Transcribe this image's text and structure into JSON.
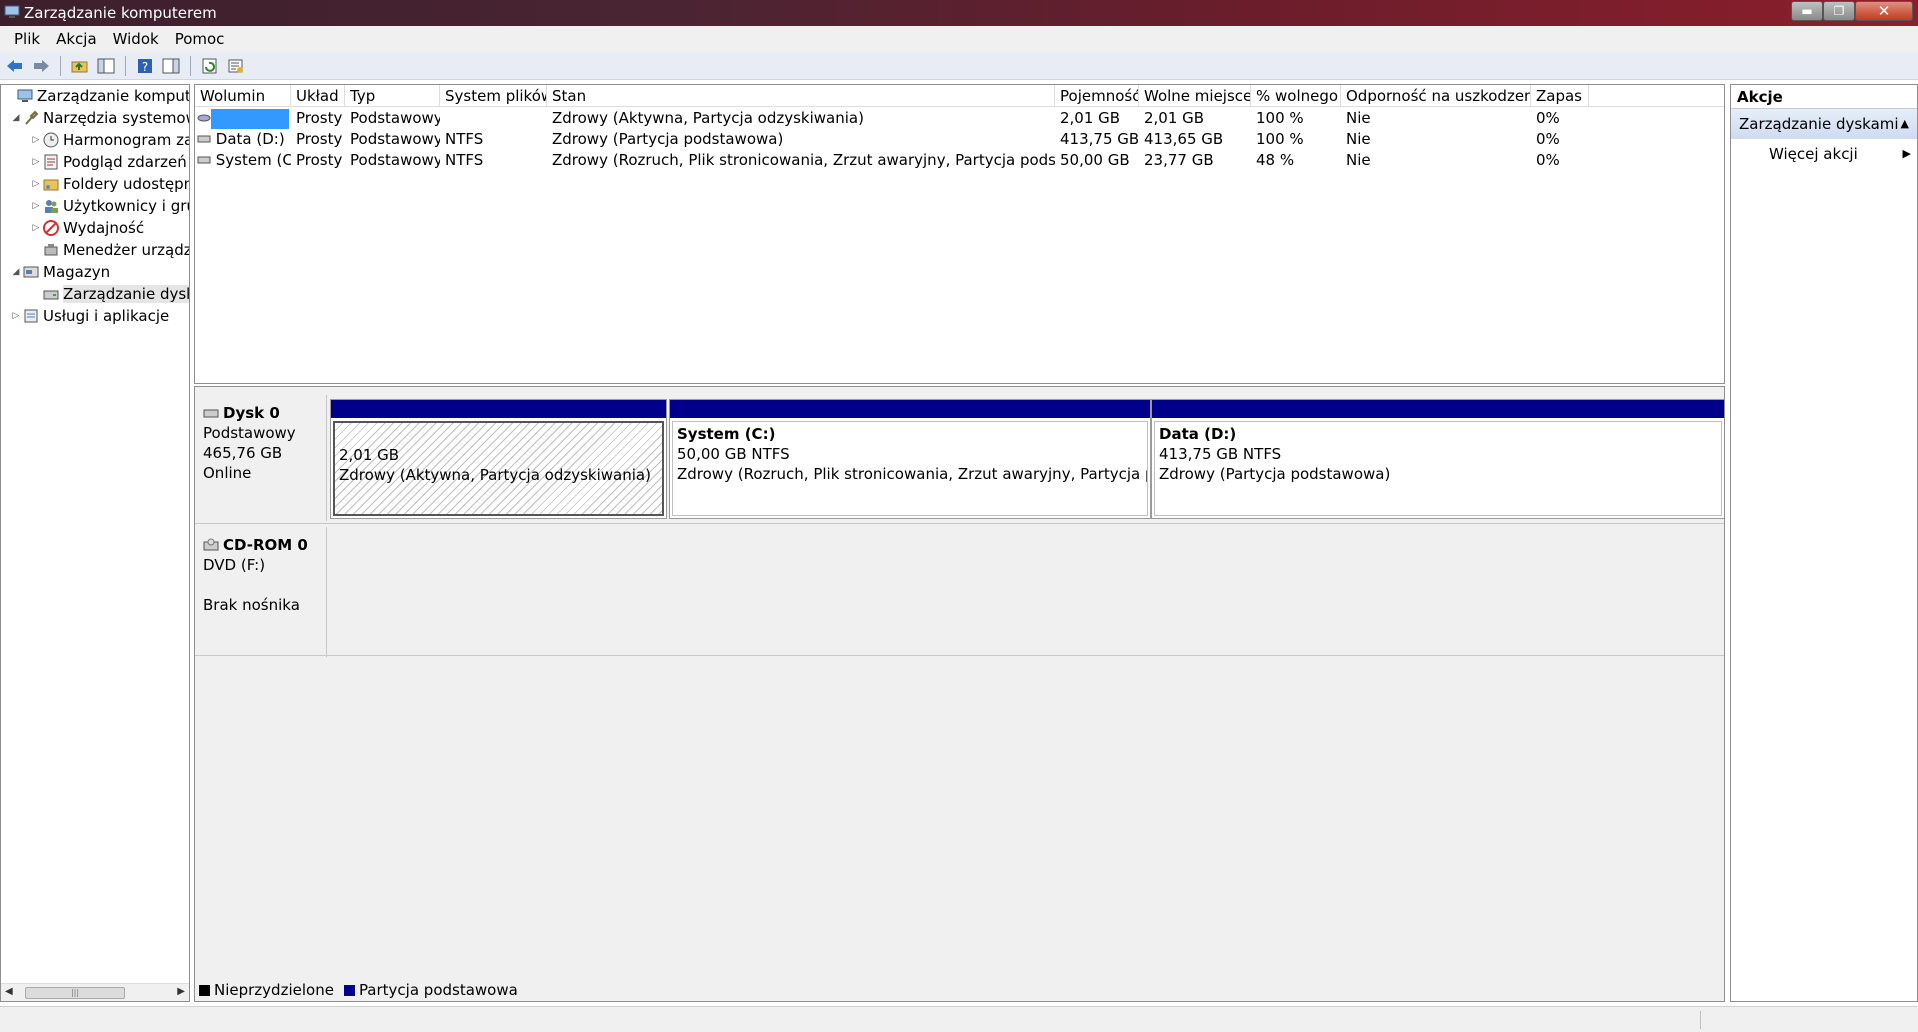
{
  "window": {
    "title": "Zarządzanie komputerem"
  },
  "menu": [
    "Plik",
    "Akcja",
    "Widok",
    "Pomoc"
  ],
  "tree": [
    {
      "label": "Zarządzanie komputerem",
      "level": 0,
      "expander": "",
      "icon": "computer-management-icon"
    },
    {
      "label": "Narzędzia systemowe",
      "level": 1,
      "expander": "◢",
      "icon": "tools-icon"
    },
    {
      "label": "Harmonogram zad",
      "level": 2,
      "expander": "▷",
      "icon": "clock-icon"
    },
    {
      "label": "Podgląd zdarzeń",
      "level": 2,
      "expander": "▷",
      "icon": "event-viewer-icon"
    },
    {
      "label": "Foldery udostępnic",
      "level": 2,
      "expander": "▷",
      "icon": "shared-folder-icon"
    },
    {
      "label": "Użytkownicy i grup",
      "level": 2,
      "expander": "▷",
      "icon": "users-icon"
    },
    {
      "label": "Wydajność",
      "level": 2,
      "expander": "▷",
      "icon": "performance-icon"
    },
    {
      "label": "Menedżer urządzer",
      "level": 2,
      "expander": "",
      "icon": "device-manager-icon"
    },
    {
      "label": "Magazyn",
      "level": 1,
      "expander": "◢",
      "icon": "storage-icon"
    },
    {
      "label": "Zarządzanie dyska",
      "level": 2,
      "expander": "",
      "icon": "disk-management-icon",
      "selected": true
    },
    {
      "label": "Usługi i aplikacje",
      "level": 1,
      "expander": "▷",
      "icon": "services-icon"
    }
  ],
  "volumes": {
    "columns": [
      "Wolumin",
      "Układ",
      "Typ",
      "System plików",
      "Stan",
      "Pojemność",
      "Wolne miejsce",
      "% wolnego",
      "Odporność na uszkodzenia",
      "Zapas"
    ],
    "rows": [
      {
        "name": "",
        "layout": "Prosty",
        "type": "Podstawowy",
        "fs": "",
        "status": "Zdrowy (Aktywna, Partycja odzyskiwania)",
        "capacity": "2,01 GB",
        "free": "2,01 GB",
        "pct": "100 %",
        "fault": "Nie",
        "overhead": "0%"
      },
      {
        "name": "Data (D:)",
        "layout": "Prosty",
        "type": "Podstawowy",
        "fs": "NTFS",
        "status": "Zdrowy (Partycja podstawowa)",
        "capacity": "413,75 GB",
        "free": "413,65 GB",
        "pct": "100 %",
        "fault": "Nie",
        "overhead": "0%"
      },
      {
        "name": "System (C:)",
        "layout": "Prosty",
        "type": "Podstawowy",
        "fs": "NTFS",
        "status": "Zdrowy (Rozruch, Plik stronicowania, Zrzut awaryjny, Partycja podstawowa)",
        "capacity": "50,00 GB",
        "free": "23,77 GB",
        "pct": "48 %",
        "fault": "Nie",
        "overhead": "0%"
      }
    ]
  },
  "disks": {
    "disk0": {
      "name": "Dysk 0",
      "type": "Podstawowy",
      "size": "465,76 GB",
      "status": "Online"
    },
    "partitions": [
      {
        "name": "",
        "size": "2,01 GB",
        "status": "Zdrowy (Aktywna, Partycja odzyskiwania)"
      },
      {
        "name": "System  (C:)",
        "size": "50,00 GB NTFS",
        "status": "Zdrowy (Rozruch, Plik stronicowania, Zrzut awaryjny, Partycja podstawowa)"
      },
      {
        "name": "Data  (D:)",
        "size": "413,75 GB NTFS",
        "status": "Zdrowy (Partycja podstawowa)"
      }
    ],
    "cdrom": {
      "name": "CD-ROM 0",
      "drive": "DVD (F:)",
      "status": "Brak nośnika"
    }
  },
  "legend": [
    {
      "label": "Nieprzydzielone",
      "color": "#000000"
    },
    {
      "label": "Partycja podstawowa",
      "color": "#00008b"
    }
  ],
  "actions": {
    "header": "Akcje",
    "section": "Zarządzanie dyskami",
    "more": "Więcej akcji"
  }
}
